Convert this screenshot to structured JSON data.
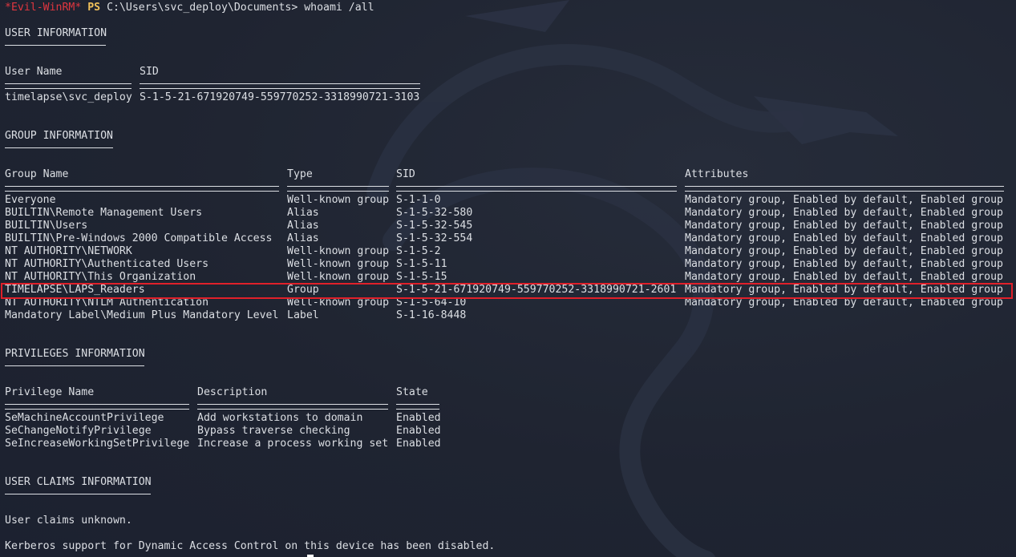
{
  "prompt": {
    "evil": "*Evil-WinRM*",
    "ps": "PS",
    "path": "C:\\Users\\svc_deploy\\Documents>",
    "command": "whoami /all"
  },
  "user_info": {
    "heading": "USER INFORMATION",
    "col_user": "User Name",
    "col_sid": "SID",
    "user_name": "timelapse\\svc_deploy",
    "sid": "S-1-5-21-671920749-559770252-3318990721-3103"
  },
  "group_info": {
    "heading": "GROUP INFORMATION",
    "col_name": "Group Name",
    "col_type": "Type",
    "col_sid": "SID",
    "col_attr": "Attributes",
    "rows": [
      {
        "name": "Everyone",
        "type": "Well-known group",
        "sid": "S-1-1-0",
        "attr": "Mandatory group, Enabled by default, Enabled group"
      },
      {
        "name": "BUILTIN\\Remote Management Users",
        "type": "Alias",
        "sid": "S-1-5-32-580",
        "attr": "Mandatory group, Enabled by default, Enabled group"
      },
      {
        "name": "BUILTIN\\Users",
        "type": "Alias",
        "sid": "S-1-5-32-545",
        "attr": "Mandatory group, Enabled by default, Enabled group"
      },
      {
        "name": "BUILTIN\\Pre-Windows 2000 Compatible Access",
        "type": "Alias",
        "sid": "S-1-5-32-554",
        "attr": "Mandatory group, Enabled by default, Enabled group"
      },
      {
        "name": "NT AUTHORITY\\NETWORK",
        "type": "Well-known group",
        "sid": "S-1-5-2",
        "attr": "Mandatory group, Enabled by default, Enabled group"
      },
      {
        "name": "NT AUTHORITY\\Authenticated Users",
        "type": "Well-known group",
        "sid": "S-1-5-11",
        "attr": "Mandatory group, Enabled by default, Enabled group"
      },
      {
        "name": "NT AUTHORITY\\This Organization",
        "type": "Well-known group",
        "sid": "S-1-5-15",
        "attr": "Mandatory group, Enabled by default, Enabled group"
      },
      {
        "name": "TIMELAPSE\\LAPS_Readers",
        "type": "Group",
        "sid": "S-1-5-21-671920749-559770252-3318990721-2601",
        "attr": "Mandatory group, Enabled by default, Enabled group"
      },
      {
        "name": "NT AUTHORITY\\NTLM Authentication",
        "type": "Well-known group",
        "sid": "S-1-5-64-10",
        "attr": "Mandatory group, Enabled by default, Enabled group"
      },
      {
        "name": "Mandatory Label\\Medium Plus Mandatory Level",
        "type": "Label",
        "sid": "S-1-16-8448",
        "attr": ""
      }
    ]
  },
  "privileges_info": {
    "heading": "PRIVILEGES INFORMATION",
    "col_name": "Privilege Name",
    "col_desc": "Description",
    "col_state": "State",
    "rows": [
      {
        "name": "SeMachineAccountPrivilege",
        "desc": "Add workstations to domain",
        "state": "Enabled"
      },
      {
        "name": "SeChangeNotifyPrivilege",
        "desc": "Bypass traverse checking",
        "state": "Enabled"
      },
      {
        "name": "SeIncreaseWorkingSetPrivilege",
        "desc": "Increase a process working set",
        "state": "Enabled"
      }
    ]
  },
  "claims_info": {
    "heading": "USER CLAIMS INFORMATION",
    "message": "User claims unknown.",
    "kerberos": "Kerberos support for Dynamic Access Control on this device has been disabled."
  },
  "colors": {
    "background": "#1e2330",
    "text": "#dcdfe4",
    "evil_prompt": "#e0363f",
    "ps_prompt": "#f0c05a",
    "highlight_box": "#e0202a"
  }
}
